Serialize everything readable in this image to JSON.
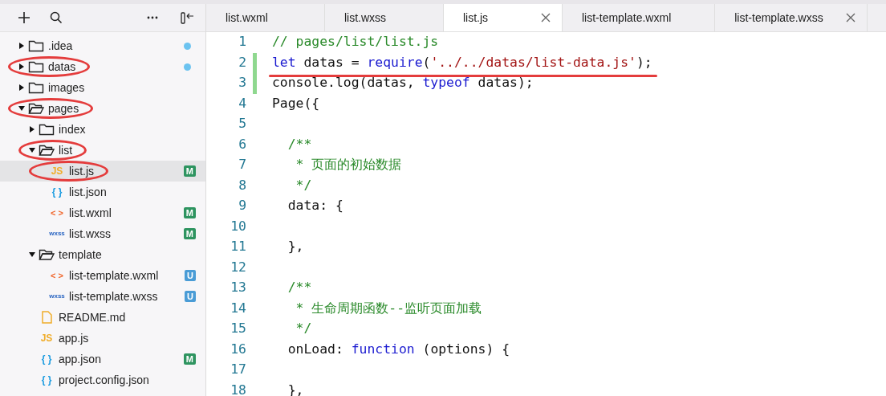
{
  "toolbar": {
    "buttons": [
      {
        "kind": "add"
      },
      {
        "kind": "search"
      },
      {
        "kind": "more"
      },
      {
        "kind": "collapse"
      }
    ]
  },
  "tabs": [
    {
      "label": "list.wxml",
      "selected": false,
      "show_close": false
    },
    {
      "label": "list.wxss",
      "selected": false,
      "show_close": false
    },
    {
      "label": "list.js",
      "selected": true,
      "show_close": true
    },
    {
      "label": "list-template.wxml",
      "selected": false,
      "show_close": false
    },
    {
      "label": "list-template.wxss",
      "selected": false,
      "show_close": true
    }
  ],
  "tree": [
    {
      "label": ".idea",
      "kind": "folder",
      "expanded": false,
      "selected": false,
      "circled": false,
      "dot": {
        "color": "#6cc3f0"
      }
    },
    {
      "label": "datas",
      "kind": "folder",
      "expanded": false,
      "selected": false,
      "circled": true,
      "dot": {
        "color": "#6cc3f0"
      }
    },
    {
      "label": "images",
      "kind": "folder",
      "expanded": false,
      "selected": false,
      "circled": false
    },
    {
      "label": "pages",
      "kind": "folder",
      "expanded": true,
      "selected": false,
      "circled": true,
      "children": [
        {
          "label": "index",
          "kind": "folder",
          "expanded": false,
          "selected": false,
          "circled": false
        },
        {
          "label": "list",
          "kind": "folder",
          "expanded": true,
          "selected": false,
          "circled": true,
          "children": [
            {
              "label": "list.js",
              "kind": "js",
              "icon_text": "JS",
              "selected": true,
              "circled": true,
              "badge": {
                "text": "M",
                "color": "#2e9460"
              }
            },
            {
              "label": "list.json",
              "kind": "json",
              "icon_text": "{ }",
              "selected": false,
              "circled": false
            },
            {
              "label": "list.wxml",
              "kind": "wxml",
              "icon_text": "< >",
              "selected": false,
              "circled": false,
              "badge": {
                "text": "M",
                "color": "#2e9460"
              }
            },
            {
              "label": "list.wxss",
              "kind": "wxss",
              "icon_text": "wxss",
              "selected": false,
              "circled": false,
              "badge": {
                "text": "M",
                "color": "#2e9460"
              }
            }
          ]
        },
        {
          "label": "template",
          "kind": "folder",
          "expanded": true,
          "selected": false,
          "circled": false,
          "children": [
            {
              "label": "list-template.wxml",
              "kind": "wxml",
              "icon_text": "< >",
              "selected": false,
              "circled": false,
              "badge": {
                "text": "U",
                "color": "#4a9cd6"
              }
            },
            {
              "label": "list-template.wxss",
              "kind": "wxss",
              "icon_text": "wxss",
              "selected": false,
              "circled": false,
              "badge": {
                "text": "U",
                "color": "#4a9cd6"
              }
            }
          ]
        }
      ]
    },
    {
      "label": "README.md",
      "kind": "md",
      "selected": false,
      "circled": false
    },
    {
      "label": "app.js",
      "kind": "js",
      "icon_text": "JS",
      "selected": false,
      "circled": false
    },
    {
      "label": "app.json",
      "kind": "json",
      "icon_text": "{ }",
      "selected": false,
      "circled": false,
      "badge": {
        "text": "M",
        "color": "#2e9460"
      }
    },
    {
      "label": "project.config.json",
      "kind": "json",
      "icon_text": "{ }",
      "selected": false,
      "circled": false
    }
  ],
  "code": [
    {
      "number": "1",
      "modified": false,
      "underlined": false,
      "tokens": [
        {
          "kind": "comment",
          "text": "// pages/list/list.js"
        }
      ]
    },
    {
      "number": "2",
      "modified": true,
      "underlined": true,
      "tokens": [
        {
          "kind": "keyword",
          "text": "let"
        },
        {
          "kind": "plain",
          "text": " datas = "
        },
        {
          "kind": "keyword",
          "text": "require"
        },
        {
          "kind": "plain",
          "text": "("
        },
        {
          "kind": "string",
          "text": "'../../datas/list-data.js'"
        },
        {
          "kind": "plain",
          "text": ");"
        }
      ]
    },
    {
      "number": "3",
      "modified": true,
      "underlined": false,
      "tokens": [
        {
          "kind": "plain",
          "text": "console.log(datas, "
        },
        {
          "kind": "keyword",
          "text": "typeof"
        },
        {
          "kind": "plain",
          "text": " datas);"
        }
      ]
    },
    {
      "number": "4",
      "modified": false,
      "underlined": false,
      "tokens": [
        {
          "kind": "plain",
          "text": "Page({"
        }
      ]
    },
    {
      "number": "5",
      "modified": false,
      "underlined": false
    },
    {
      "number": "6",
      "modified": false,
      "underlined": false,
      "tokens": [
        {
          "kind": "comment",
          "text": "  /**"
        }
      ]
    },
    {
      "number": "7",
      "modified": false,
      "underlined": false,
      "tokens": [
        {
          "kind": "comment",
          "text": "   * 页面的初始数据"
        }
      ]
    },
    {
      "number": "8",
      "modified": false,
      "underlined": false,
      "tokens": [
        {
          "kind": "comment",
          "text": "   */"
        }
      ]
    },
    {
      "number": "9",
      "modified": false,
      "underlined": false,
      "tokens": [
        {
          "kind": "plain",
          "text": "  data: {"
        }
      ]
    },
    {
      "number": "10",
      "modified": false,
      "underlined": false
    },
    {
      "number": "11",
      "modified": false,
      "underlined": false,
      "tokens": [
        {
          "kind": "plain",
          "text": "  },"
        }
      ]
    },
    {
      "number": "12",
      "modified": false,
      "underlined": false
    },
    {
      "number": "13",
      "modified": false,
      "underlined": false,
      "tokens": [
        {
          "kind": "comment",
          "text": "  /**"
        }
      ]
    },
    {
      "number": "14",
      "modified": false,
      "underlined": false,
      "tokens": [
        {
          "kind": "comment",
          "text": "   * 生命周期函数--监听页面加载"
        }
      ]
    },
    {
      "number": "15",
      "modified": false,
      "underlined": false,
      "tokens": [
        {
          "kind": "comment",
          "text": "   */"
        }
      ]
    },
    {
      "number": "16",
      "modified": false,
      "underlined": false,
      "tokens": [
        {
          "kind": "plain",
          "text": "  onLoad: "
        },
        {
          "kind": "keyword",
          "text": "function"
        },
        {
          "kind": "plain",
          "text": " (options) {"
        }
      ]
    },
    {
      "number": "17",
      "modified": false,
      "underlined": false
    },
    {
      "number": "18",
      "modified": false,
      "underlined": false,
      "tokens": [
        {
          "kind": "plain",
          "text": "  },"
        }
      ]
    }
  ]
}
